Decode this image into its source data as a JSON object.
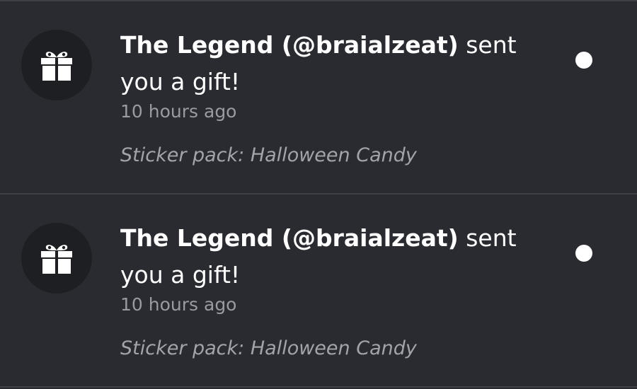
{
  "notifications": [
    {
      "sender": "The Legend (@braialzeat)",
      "action": " sent you a gift!",
      "time": "10 hours ago",
      "detail": "Sticker pack: Halloween Candy",
      "icon": "gift-icon",
      "unread": true
    },
    {
      "sender": "The Legend (@braialzeat)",
      "action": " sent you a gift!",
      "time": "10 hours ago",
      "detail": "Sticker pack: Halloween Candy",
      "icon": "gift-icon",
      "unread": true
    }
  ],
  "colors": {
    "background": "#2a2b30",
    "avatar_bg": "#1e1f22",
    "divider": "#404146",
    "secondary_text": "#9a9ba0",
    "unread_dot": "#ffffff"
  }
}
